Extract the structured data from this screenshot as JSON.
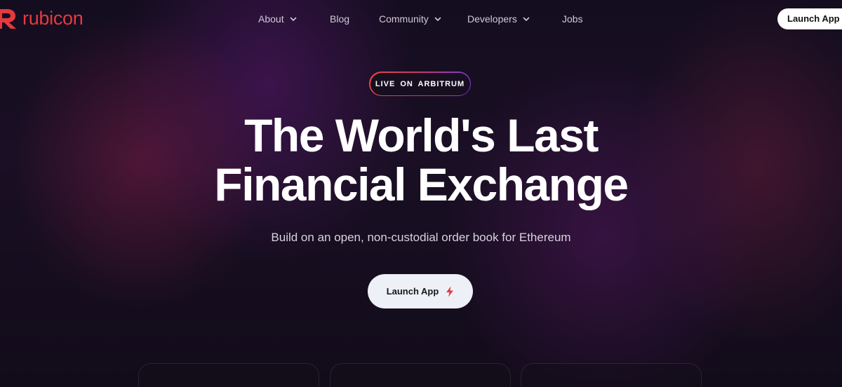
{
  "brand": {
    "name": "rubicon",
    "color": "#e5393f"
  },
  "nav": {
    "items": [
      {
        "label": "About",
        "has_dropdown": true
      },
      {
        "label": "Blog",
        "has_dropdown": false
      },
      {
        "label": "Community",
        "has_dropdown": true
      },
      {
        "label": "Developers",
        "has_dropdown": true
      },
      {
        "label": "Jobs",
        "has_dropdown": false
      }
    ],
    "launch_label": "Launch App"
  },
  "hero": {
    "badge": "LIVE ON  ARBITRUM",
    "headline_line1": "The World's Last",
    "headline_line2": "Financial Exchange",
    "subhead": "Build on an open, non-custodial order book for Ethereum",
    "cta_label": "Launch App",
    "cta_icon": "lightning-bolt-icon"
  },
  "colors": {
    "accent": "#e5393f",
    "badge_gradient_start": "#e8483e",
    "badge_gradient_end": "#7a3ad9",
    "background": "#140d1f"
  }
}
